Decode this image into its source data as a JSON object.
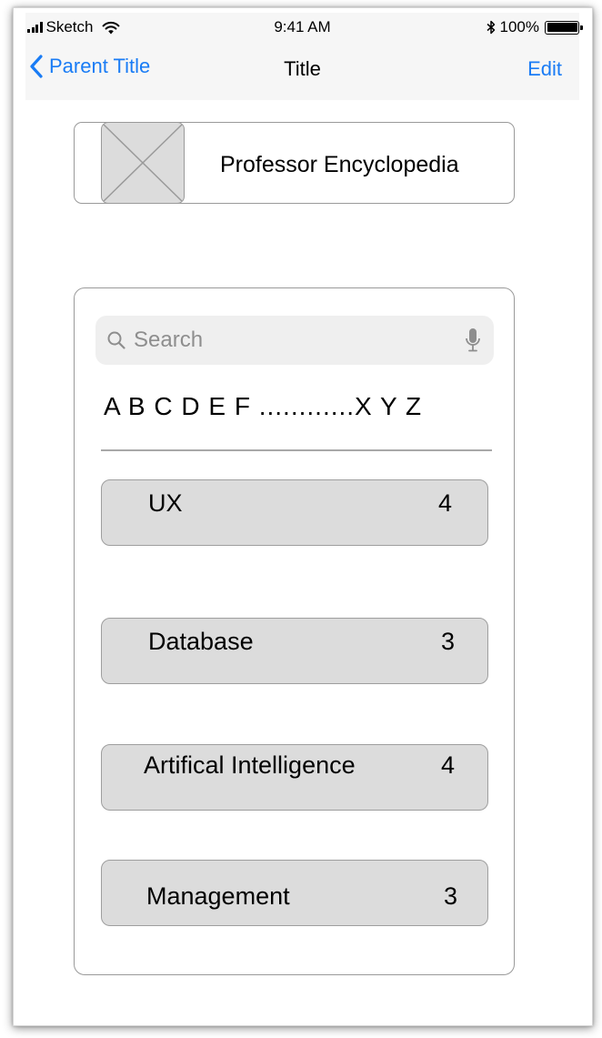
{
  "status_bar": {
    "carrier": "Sketch",
    "time": "9:41 AM",
    "battery": "100%"
  },
  "nav": {
    "back_label": "Parent Title",
    "title": "Title",
    "edit_label": "Edit"
  },
  "header": {
    "title": "Professor Encyclopedia"
  },
  "search": {
    "placeholder": "Search"
  },
  "alpha_index": "A B C D E F ............X Y Z",
  "categories": [
    {
      "label": "UX",
      "count": "4"
    },
    {
      "label": "Database",
      "count": "3"
    },
    {
      "label": "Artifical Intelligence",
      "count": "4"
    },
    {
      "label": "Management",
      "count": "3"
    }
  ],
  "colors": {
    "accent": "#1a7cf5",
    "nav_background": "#f6f6f6",
    "card_fill": "#dcdcdc",
    "border": "#9a9a9a"
  }
}
